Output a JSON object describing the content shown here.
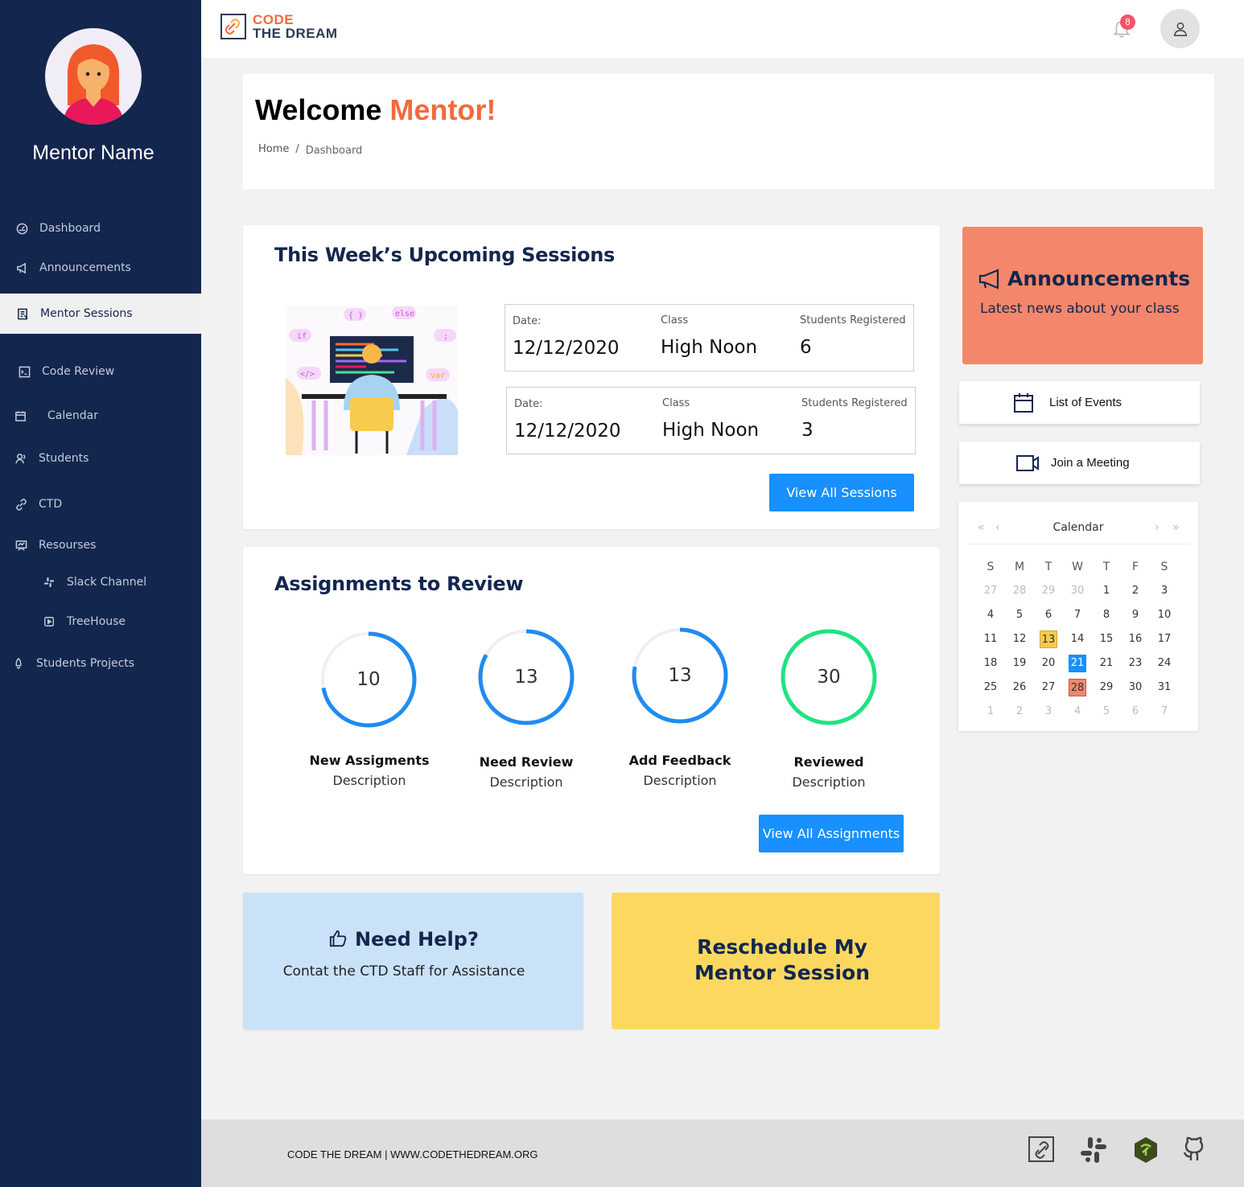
{
  "sidebar": {
    "user_name": "Mentor Name",
    "items": [
      {
        "label": "Dashboard",
        "icon": "dashboard-icon"
      },
      {
        "label": "Announcements",
        "icon": "megaphone-icon"
      },
      {
        "label": "Mentor Sessions",
        "icon": "sessions-icon"
      },
      {
        "label": "Code Review",
        "icon": "code-icon"
      },
      {
        "label": "Calendar",
        "icon": "calendar-icon"
      },
      {
        "label": "Students",
        "icon": "students-icon"
      },
      {
        "label": "CTD",
        "icon": "link-icon"
      },
      {
        "label": "Resourses",
        "icon": "resources-icon"
      },
      {
        "label": "Slack Channel",
        "icon": "slack-icon"
      },
      {
        "label": "TreeHouse",
        "icon": "play-icon"
      },
      {
        "label": "Students Projects",
        "icon": "rocket-icon"
      }
    ],
    "active_item": "Mentor Sessions"
  },
  "header": {
    "logo_line1": "CODE",
    "logo_line2": "THE DREAM",
    "notification_count": "8"
  },
  "welcome": {
    "title_prefix": "Welcome ",
    "title_accent": "Mentor!",
    "breadcrumb_home": "Home",
    "breadcrumb_sep": "/",
    "breadcrumb_current": "Dashboard"
  },
  "sessions": {
    "title": "This Week’s Upcoming Sessions",
    "date_label": "Date:",
    "class_label": "Class",
    "students_label": "Students Registered",
    "rows": [
      {
        "date": "12/12/2020",
        "class": "High Noon",
        "students": "6"
      },
      {
        "date": "12/12/2020",
        "class": "High Noon",
        "students": "3"
      }
    ],
    "view_all": "View All Sessions",
    "illustration_tags": [
      "{ }",
      "else",
      "if",
      ";",
      "</>",
      "var"
    ]
  },
  "assignments": {
    "title": "Assignments to Review",
    "items": [
      {
        "count": "10",
        "title": "New Assigments",
        "desc": "Description",
        "fraction": 0.72,
        "color": "#1f8bf0"
      },
      {
        "count": "13",
        "title": "Need Review",
        "desc": "Description",
        "fraction": 0.83,
        "color": "#1f8bf0"
      },
      {
        "count": "13",
        "title": "Add Feedback",
        "desc": "Description",
        "fraction": 0.78,
        "color": "#1f8bf0"
      },
      {
        "count": "30",
        "title": "Reviewed",
        "desc": "Description",
        "fraction": 1.0,
        "color": "#1ee37f"
      }
    ],
    "view_all": "View All Assignments"
  },
  "announcements": {
    "title": "Announcements",
    "subtitle": "Latest news about your class",
    "color": "#f4876b"
  },
  "quick_links": {
    "events": "List of Events",
    "meeting": "Join a Meeting"
  },
  "calendar": {
    "title": "Calendar",
    "prev_year": "«",
    "prev_month": "‹",
    "next_month": "›",
    "next_year": "»",
    "weekdays": [
      "S",
      "M",
      "T",
      "W",
      "T",
      "F",
      "S"
    ],
    "weeks": [
      [
        "27",
        "28",
        "29",
        "30",
        "1",
        "2",
        "3"
      ],
      [
        "4",
        "5",
        "6",
        "7",
        "8",
        "9",
        "10"
      ],
      [
        "11",
        "12",
        "13",
        "14",
        "15",
        "16",
        "17"
      ],
      [
        "18",
        "19",
        "20",
        "21",
        "21",
        "23",
        "24"
      ],
      [
        "25",
        "26",
        "27",
        "28",
        "29",
        "30",
        "31"
      ],
      [
        "1",
        "2",
        "3",
        "4",
        "5",
        "6",
        "7"
      ]
    ],
    "muted": [
      [
        0,
        0
      ],
      [
        0,
        1
      ],
      [
        0,
        2
      ],
      [
        0,
        3
      ],
      [
        5,
        0
      ],
      [
        5,
        1
      ],
      [
        5,
        2
      ],
      [
        5,
        3
      ],
      [
        5,
        4
      ],
      [
        5,
        5
      ],
      [
        5,
        6
      ]
    ],
    "highlight_yellow": [
      2,
      2
    ],
    "highlight_blue": [
      3,
      3
    ],
    "highlight_red": [
      4,
      3
    ]
  },
  "help": {
    "title": "Need Help?",
    "subtitle": "Contat the CTD Staff for Assistance"
  },
  "reschedule": {
    "line1": "Reschedule My",
    "line2": "Mentor Session"
  },
  "footer": {
    "text": "CODE THE DREAM | WWW.CODETHEDREAM.ORG",
    "icons": [
      "ctd-link-icon",
      "slack-icon",
      "treehouse-icon",
      "github-icon"
    ]
  }
}
